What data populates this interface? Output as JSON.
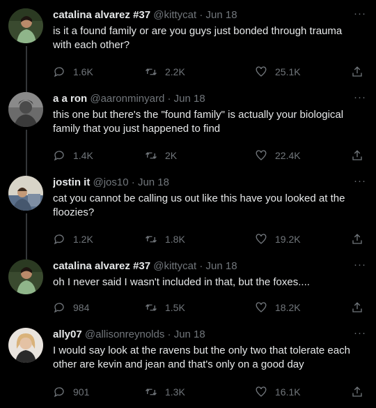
{
  "colors": {
    "background": "#000000",
    "text": "#e7e9ea",
    "secondary": "#71767b",
    "thread_line": "#333639"
  },
  "tweets": [
    {
      "display_name": "catalina alvarez #37",
      "handle": "@kittycat",
      "separator": "·",
      "date": "Jun 18",
      "more_label": "···",
      "text": "is it a found family or are you guys just bonded through trauma with each other?",
      "replies": "1.6K",
      "retweets": "2.2K",
      "likes": "25.1K"
    },
    {
      "display_name": "a a ron",
      "handle": "@aaronminyard",
      "separator": "·",
      "date": "Jun 18",
      "more_label": "···",
      "text": "this one but there's the \"found family\" is actually your biological family that you just happened to find",
      "replies": "1.4K",
      "retweets": "2K",
      "likes": "22.4K"
    },
    {
      "display_name": "jostin it",
      "handle": "@jos10",
      "separator": "·",
      "date": "Jun 18",
      "more_label": "···",
      "text": "cat you cannot be calling us out like this have you looked at the floozies?",
      "replies": "1.2K",
      "retweets": "1.8K",
      "likes": "19.2K"
    },
    {
      "display_name": "catalina alvarez #37",
      "handle": "@kittycat",
      "separator": "·",
      "date": "Jun 18",
      "more_label": "···",
      "text": "oh I never said I wasn't included in that, but the foxes....",
      "replies": "984",
      "retweets": "1.5K",
      "likes": "18.2K"
    },
    {
      "display_name": "ally07",
      "handle": "@allisonreynolds",
      "separator": "·",
      "date": "Jun 18",
      "more_label": "···",
      "text": "I would say look at the ravens but the only two that tolerate each other are kevin and jean and that's only on a good day",
      "replies": "901",
      "retweets": "1.3K",
      "likes": "16.1K"
    }
  ]
}
